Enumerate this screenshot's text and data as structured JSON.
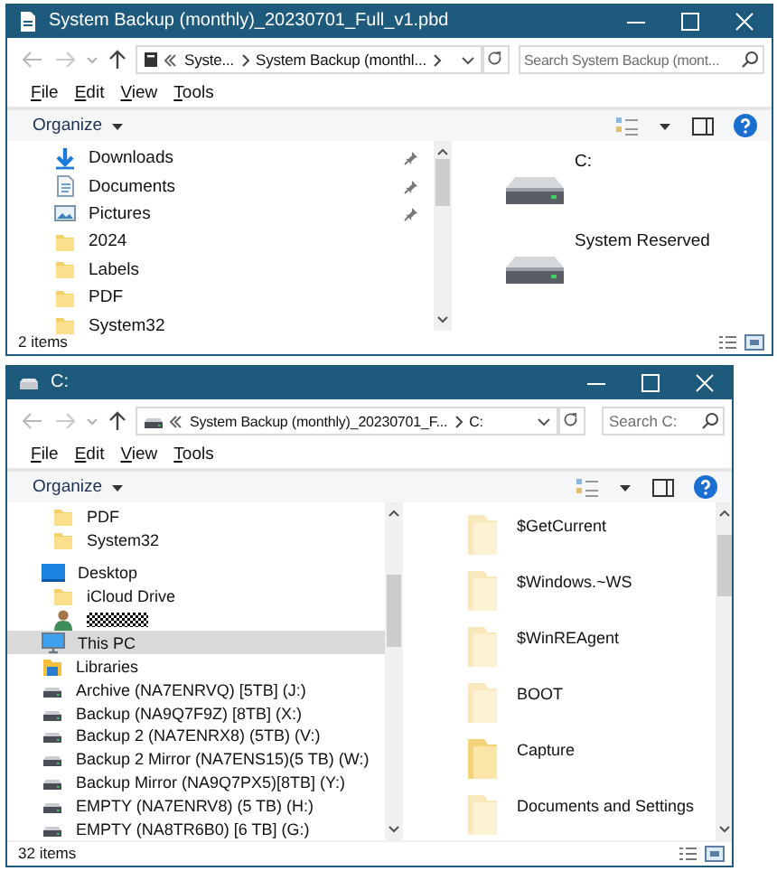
{
  "windows": [
    {
      "kind": "backup_file",
      "title": "System Backup (monthly)_20230701_Full_v1.pbd",
      "address": {
        "crumbs": [
          "Syste...",
          "System Backup (monthl..."
        ],
        "search_placeholder": "Search System Backup (mont..."
      },
      "menu": [
        "File",
        "Edit",
        "View",
        "Tools"
      ],
      "toolbar": {
        "organize": "Organize"
      },
      "nav_sections": [
        {
          "items": [
            {
              "label": "Downloads",
              "kind": "download",
              "pinned": true,
              "selected": false
            },
            {
              "label": "Documents",
              "kind": "documents",
              "pinned": true,
              "selected": false
            },
            {
              "label": "Pictures",
              "kind": "pictures",
              "pinned": true,
              "selected": false
            },
            {
              "label": "2024",
              "kind": "folder",
              "pinned": false,
              "selected": false
            },
            {
              "label": "Labels",
              "kind": "folder",
              "pinned": false,
              "selected": false
            },
            {
              "label": "PDF",
              "kind": "folder",
              "pinned": false,
              "selected": false
            },
            {
              "label": "System32",
              "kind": "folder",
              "pinned": false,
              "selected": false
            }
          ]
        }
      ],
      "content": {
        "kind": "drives",
        "items": [
          {
            "label": "C:",
            "hidden": false
          },
          {
            "label": "System Reserved",
            "hidden": false
          }
        ]
      },
      "status": "2 items"
    },
    {
      "kind": "drive",
      "title": "C:",
      "address": {
        "crumbs": [
          "System Backup (monthly)_20230701_F...",
          "C:"
        ],
        "search_placeholder": "Search C:"
      },
      "menu": [
        "File",
        "Edit",
        "View",
        "Tools"
      ],
      "toolbar": {
        "organize": "Organize"
      },
      "nav_sections": [
        {
          "items": [
            {
              "label": "PDF",
              "kind": "folder",
              "selected": false
            },
            {
              "label": "System32",
              "kind": "folder",
              "selected": false
            }
          ]
        },
        {
          "items": [
            {
              "label": "Desktop",
              "kind": "desktop",
              "selected": false
            },
            {
              "label": "iCloud Drive",
              "kind": "folder",
              "selected": false
            },
            {
              "kind": "user",
              "redacted": true,
              "selected": false
            },
            {
              "label": "This PC",
              "kind": "pc",
              "selected": true
            },
            {
              "label": "Libraries",
              "kind": "libraries",
              "selected": false
            },
            {
              "label": "Archive (NA7ENRVQ) [5TB] (J:)",
              "kind": "drive",
              "selected": false
            },
            {
              "label": "Backup (NA9Q7F9Z) [8TB] (X:)",
              "kind": "drive",
              "selected": false
            },
            {
              "label": "Backup 2 (NA7ENRX8) (5TB) (V:)",
              "kind": "drive",
              "selected": false
            },
            {
              "label": "Backup 2 Mirror (NA7ENS15)(5 TB) (W:)",
              "kind": "drive",
              "selected": false
            },
            {
              "label": "Backup Mirror (NA9Q7PX5)[8TB] (Y:)",
              "kind": "drive",
              "selected": false
            },
            {
              "label": "EMPTY (NA7ENRV8) (5 TB) (H:)",
              "kind": "drive",
              "selected": false
            },
            {
              "label": "EMPTY (NA8TR6B0) [6 TB] (G:)",
              "kind": "drive",
              "selected": false
            }
          ]
        }
      ],
      "content": {
        "kind": "folders",
        "items": [
          {
            "label": "$GetCurrent",
            "hidden": true
          },
          {
            "label": "$Windows.~WS",
            "hidden": true
          },
          {
            "label": "$WinREAgent",
            "hidden": true
          },
          {
            "label": "BOOT",
            "hidden": true
          },
          {
            "label": "Capture",
            "hidden": false
          },
          {
            "label": "Documents and Settings",
            "hidden": true
          }
        ]
      },
      "status": "32 items"
    }
  ]
}
